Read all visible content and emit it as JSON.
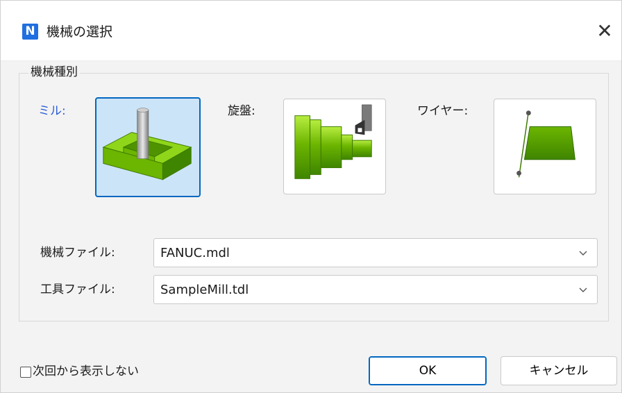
{
  "window": {
    "title": "機械の選択",
    "app_icon_letter": "N",
    "close_glyph": "✕"
  },
  "machine_group": {
    "label": "機械種別",
    "types": [
      {
        "label": "ミル:",
        "selected": true
      },
      {
        "label": "旋盤:",
        "selected": false
      },
      {
        "label": "ワイヤー:",
        "selected": false
      }
    ]
  },
  "machine_file": {
    "label": "機械ファイル:",
    "value": "FANUC.mdl"
  },
  "tool_file": {
    "label": "工具ファイル:",
    "value": "SampleMill.tdl"
  },
  "footer": {
    "dont_show_label": "次回から表示しない",
    "dont_show_checked": false,
    "ok_label": "OK",
    "cancel_label": "キャンセル"
  },
  "colors": {
    "accent": "#0067c0",
    "selected_bg": "#cce4f7",
    "selected_text": "#2a5bd7",
    "model_green": "#5fa800"
  }
}
